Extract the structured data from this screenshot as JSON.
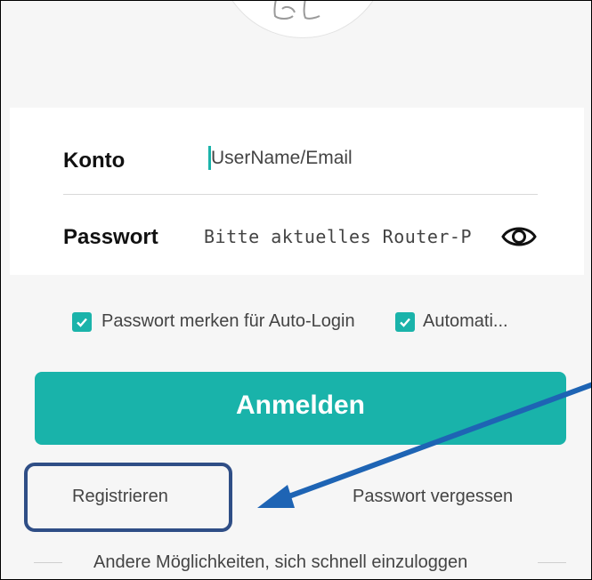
{
  "form": {
    "account_label": "Konto",
    "account_placeholder": "UserName/Email",
    "password_label": "Passwort",
    "password_placeholder": "Bitte aktuelles Router-P"
  },
  "options": {
    "remember_label": "Passwort merken für Auto-Login",
    "remember_checked": true,
    "auto_label": "Automati...",
    "auto_checked": true
  },
  "login_button_label": "Anmelden",
  "links": {
    "register": "Registrieren",
    "forgot": "Passwort vergessen"
  },
  "alt_login_text": "Andere Möglichkeiten, sich schnell einzuloggen",
  "colors": {
    "accent": "#19b3aa",
    "annotation": "#2f4e86"
  },
  "icons": [
    "eye-icon",
    "checkmark-icon",
    "avatar-illustration"
  ]
}
